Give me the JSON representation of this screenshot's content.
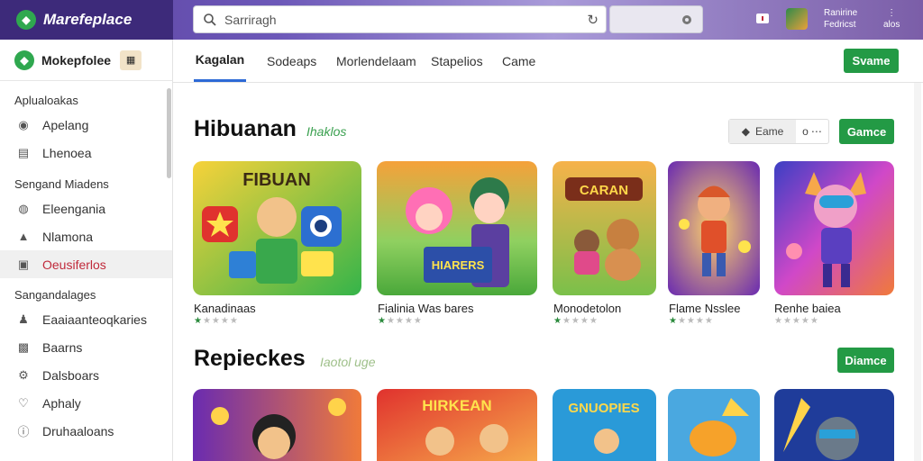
{
  "topbar": {
    "brand": "Marefeplace",
    "search_placeholder": "Sarriragh",
    "user_line1": "Ranirine",
    "user_line2": "Fedricst",
    "menu_line1": "⋮",
    "menu_line2": "alos"
  },
  "sidebar": {
    "brand": "Mokepfolee",
    "sections": [
      {
        "title": "Aplualoakas",
        "items": [
          {
            "label": "Apelang",
            "icon": "controller-icon"
          },
          {
            "label": "Lhenoea",
            "icon": "list-icon"
          }
        ]
      },
      {
        "title": "Sengand Miadens",
        "items": [
          {
            "label": "Eleengania",
            "icon": "disc-icon"
          },
          {
            "label": "Nlamona",
            "icon": "bag-icon"
          },
          {
            "label": "Oeusiferlos",
            "icon": "square-icon",
            "active": true
          }
        ]
      },
      {
        "title": "Sangandalages",
        "items": [
          {
            "label": "Eaaiaanteoqkaries",
            "icon": "people-icon"
          },
          {
            "label": "Baarns",
            "icon": "box-icon"
          },
          {
            "label": "Dalsboars",
            "icon": "gear-icon"
          },
          {
            "label": "Aphaly",
            "icon": "heart-icon"
          },
          {
            "label": "Druhaaloans",
            "icon": "info-icon"
          }
        ]
      }
    ]
  },
  "tabs": [
    {
      "label": "Kagalan",
      "active": true
    },
    {
      "label": "Sodeaps"
    },
    {
      "label": "Morlendelaam"
    },
    {
      "label": "Stapelios"
    },
    {
      "label": "Came"
    }
  ],
  "tabs_button": "Svame",
  "section1": {
    "title": "Hibuanan",
    "subtitle": "Ihaklos",
    "seg_a": "Eame",
    "seg_b": "o",
    "button": "Gamce",
    "cards": [
      {
        "title": "Kanadinaas",
        "stars": 1,
        "art": "FIBUAN"
      },
      {
        "title": "Fialinia Was bares",
        "stars": 1,
        "art": "HIARERS"
      },
      {
        "title": "Monodetolon",
        "stars": 1,
        "art": "CARAN"
      },
      {
        "title": "Flame Nsslee",
        "stars": 1,
        "art": ""
      },
      {
        "title": "Renhe baiea",
        "stars": 0,
        "art": ""
      }
    ]
  },
  "section2": {
    "title": "Repieckes",
    "subtitle": "Iaotol uge",
    "button": "Diamce",
    "cards": [
      {
        "art": ""
      },
      {
        "art": "HIRKEAN"
      },
      {
        "art": "GNUOPIES"
      },
      {
        "art": ""
      },
      {
        "art": ""
      }
    ]
  },
  "colors": {
    "accent_green": "#239a45",
    "header_purple": "#3d2a7a",
    "active_red": "#c0293a",
    "tab_blue": "#2d6ad6"
  }
}
